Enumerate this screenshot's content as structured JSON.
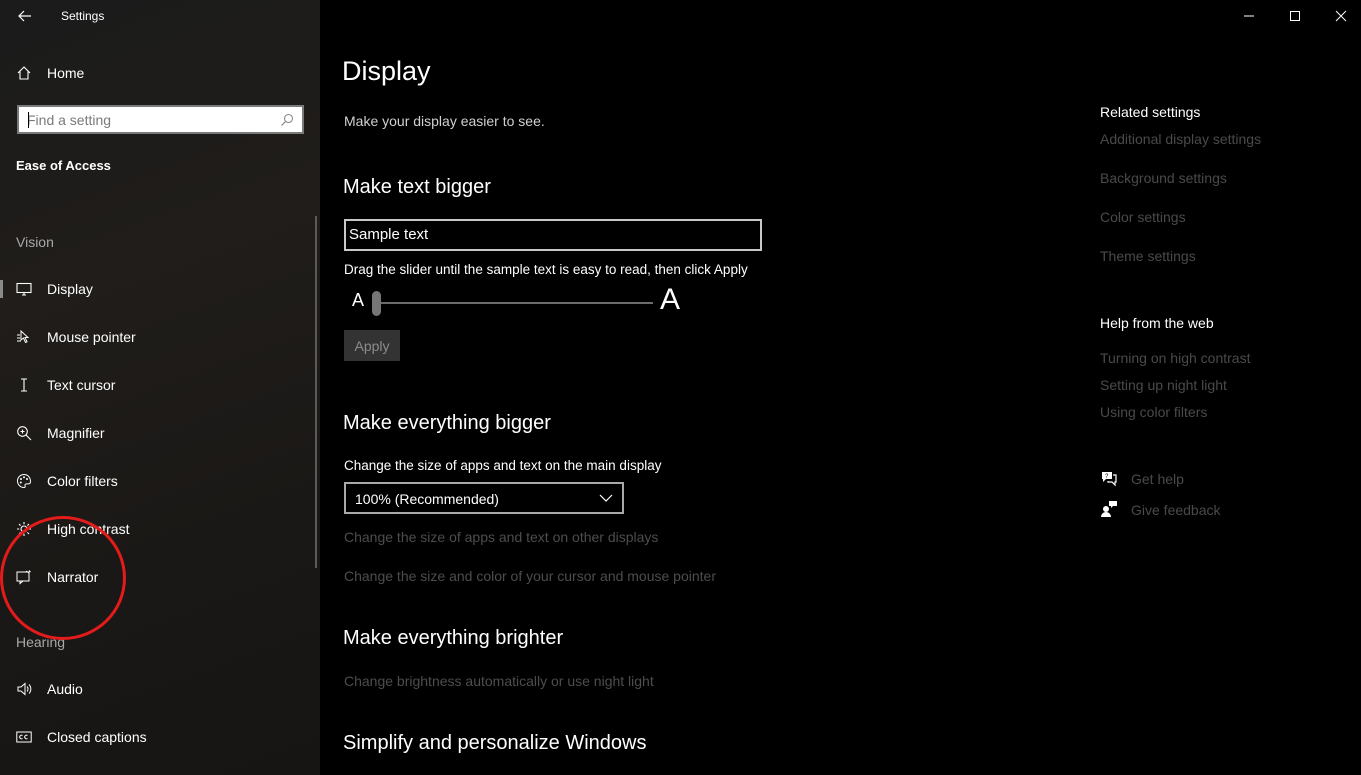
{
  "app": {
    "title": "Settings"
  },
  "sidebar": {
    "home_label": "Home",
    "search_placeholder": "Find a setting",
    "section_title": "Ease of Access",
    "group_vision": "Vision",
    "group_hearing": "Hearing",
    "items": [
      {
        "label": "Display",
        "icon": "monitor-icon",
        "selected": true
      },
      {
        "label": "Mouse pointer",
        "icon": "mouse-pointer-icon"
      },
      {
        "label": "Text cursor",
        "icon": "text-cursor-icon"
      },
      {
        "label": "Magnifier",
        "icon": "magnifier-icon"
      },
      {
        "label": "Color filters",
        "icon": "palette-icon"
      },
      {
        "label": "High contrast",
        "icon": "brightness-icon"
      },
      {
        "label": "Narrator",
        "icon": "narrator-icon"
      },
      {
        "label": "Audio",
        "icon": "speaker-icon"
      },
      {
        "label": "Closed captions",
        "icon": "closed-captions-icon"
      }
    ],
    "annotation_color": "#e31b1b"
  },
  "main": {
    "title": "Display",
    "subtitle": "Make your display easier to see.",
    "text_bigger": {
      "heading": "Make text bigger",
      "sample_text": "Sample text",
      "hint": "Drag the slider until the sample text is easy to read, then click Apply",
      "small_a": "A",
      "large_a": "A",
      "slider_value": 0,
      "apply_label": "Apply"
    },
    "everything_bigger": {
      "heading": "Make everything bigger",
      "label": "Change the size of apps and text on the main display",
      "dropdown_value": "100% (Recommended)",
      "link_other_displays": "Change the size of apps and text on other displays",
      "link_cursor": "Change the size and color of your cursor and mouse pointer"
    },
    "brighter": {
      "heading": "Make everything brighter",
      "link": "Change brightness automatically or use night light"
    },
    "simplify": {
      "heading": "Simplify and personalize Windows"
    }
  },
  "related": {
    "heading": "Related settings",
    "links": [
      "Additional display settings",
      "Background settings",
      "Color settings",
      "Theme settings"
    ]
  },
  "help": {
    "heading": "Help from the web",
    "links": [
      "Turning on high contrast",
      "Setting up night light",
      "Using color filters"
    ],
    "get_help": "Get help",
    "give_feedback": "Give feedback"
  }
}
